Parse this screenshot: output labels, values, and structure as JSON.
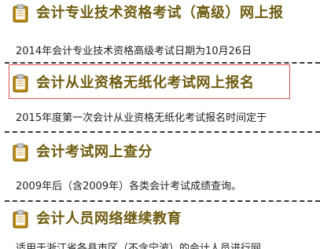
{
  "items": [
    {
      "title": "会计专业技术资格考试（高级）网上报",
      "desc": "2014年会计专业技术资格高级考试日期为10月26日"
    },
    {
      "title": "会计从业资格无纸化考试网上报名",
      "desc": "2015年度第一次会计从业资格无纸化考试报名时间定于"
    },
    {
      "title": "会计考试网上查分",
      "desc": "2009年后（含2009年）各类会计考试成绩查询。"
    },
    {
      "title": "会计人员网络继续教育",
      "desc": "适用于浙江省各县市区（不含宁波）的会计人员进行网"
    }
  ],
  "colors": {
    "title": "#6f5c10",
    "text": "#222222",
    "divider": "#3a3a3a",
    "highlight": "#d9534f",
    "icon_board": "#b8860b",
    "icon_paper": "#ffffff"
  }
}
